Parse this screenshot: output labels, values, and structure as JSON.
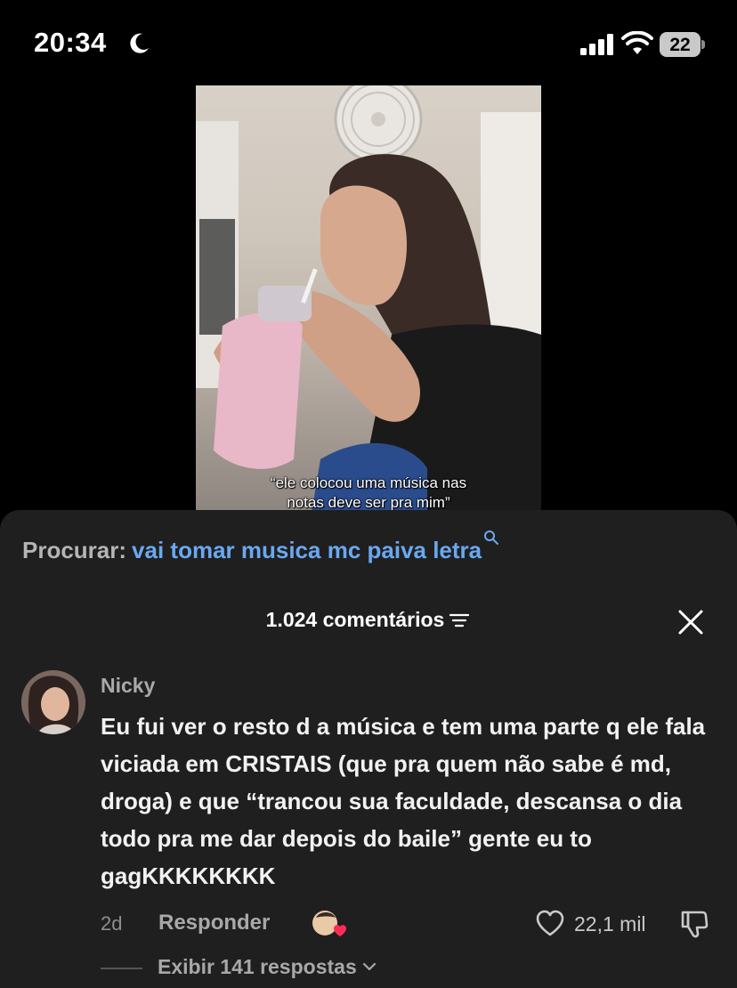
{
  "status_bar": {
    "time": "20:34",
    "battery_level": "22"
  },
  "video": {
    "caption_line1": "“ele colocou uma música nas",
    "caption_line2": "notas deve ser pra mim”"
  },
  "search": {
    "prefix": "Procurar:",
    "query": "vai tomar musica mc paiva letra",
    "accent_color": "#6aa8f0"
  },
  "comments": {
    "header": "1.024 comentários",
    "items": [
      {
        "username": "Nicky",
        "text": "Eu fui ver o resto d a música e tem uma parte q ele fala viciada em CRISTAIS (que pra quem não sabe é md, droga) e que “trancou sua faculdade, descansa o dia todo pra me dar depois do baile” gente eu to gagKKKKKKKK",
        "time": "2d",
        "reply_label": "Responder",
        "like_count": "22,1 mil",
        "replies_label": "Exibir 141 respostas"
      }
    ]
  },
  "icons": [
    "moon-icon",
    "signal-icon",
    "wifi-icon",
    "battery-icon",
    "search-icon",
    "filter-icon",
    "close-icon",
    "creator-like-icon",
    "heart-icon",
    "dislike-icon",
    "chevron-down-icon"
  ]
}
